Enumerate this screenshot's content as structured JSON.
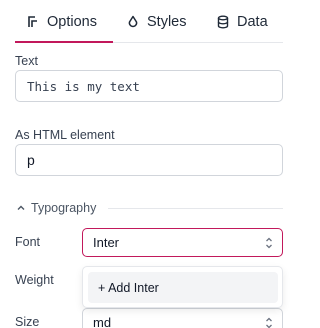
{
  "tabs": [
    {
      "label": "Options",
      "icon": "sliders-icon",
      "active": true
    },
    {
      "label": "Styles",
      "icon": "droplet-icon",
      "active": false
    },
    {
      "label": "Data",
      "icon": "database-icon",
      "active": false
    }
  ],
  "accent_color": "#c2185b",
  "text_field": {
    "label": "Text",
    "value": "This is my text"
  },
  "html_element_field": {
    "label": "As HTML element",
    "value": "p"
  },
  "typography": {
    "title": "Typography",
    "font": {
      "label": "Font",
      "value": "Inter"
    },
    "weight": {
      "label": "Weight"
    },
    "size": {
      "label": "Size",
      "value": "md"
    },
    "dropdown": {
      "item": "+ Add Inter"
    }
  }
}
